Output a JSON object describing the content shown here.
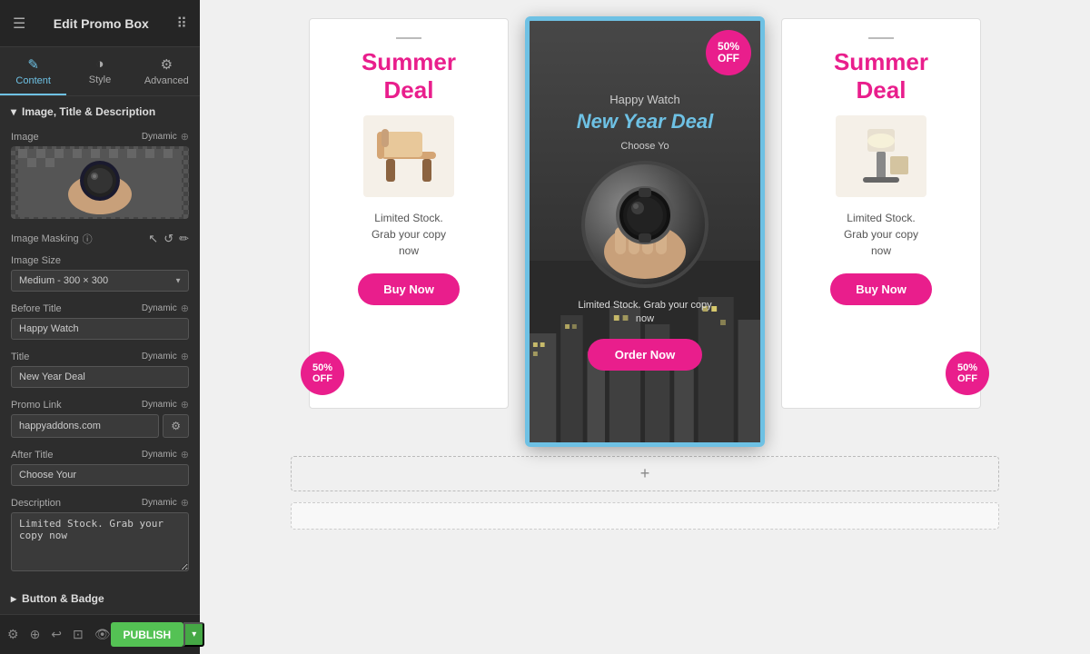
{
  "sidebar": {
    "title": "Edit Promo Box",
    "tabs": [
      {
        "id": "content",
        "label": "Content",
        "icon": "✎",
        "active": true
      },
      {
        "id": "style",
        "label": "Style",
        "icon": "◑",
        "active": false
      },
      {
        "id": "advanced",
        "label": "Advanced",
        "icon": "⚙",
        "active": false
      }
    ],
    "sections": {
      "image_title": {
        "label": "Image, Title & Description",
        "fields": {
          "image_label": "Image",
          "image_dynamic": "Dynamic",
          "image_masking_label": "Image Masking",
          "image_size_label": "Image Size",
          "image_size_value": "Medium - 300 × 300",
          "before_title_label": "Before Title",
          "before_title_dynamic": "Dynamic",
          "before_title_value": "Happy Watch",
          "title_label": "Title",
          "title_dynamic": "Dynamic",
          "title_value": "New Year Deal",
          "promo_link_label": "Promo Link",
          "promo_link_dynamic": "Dynamic",
          "promo_link_value": "happyaddons.com",
          "after_title_label": "After Title",
          "after_title_dynamic": "Dynamic",
          "after_title_value": "Choose Your",
          "description_label": "Description",
          "description_dynamic": "Dynamic",
          "description_value": "Limited Stock. Grab your copy now"
        }
      },
      "button_badge": {
        "label": "Button & Badge"
      }
    },
    "bottom": {
      "publish_label": "PUBLISH"
    }
  },
  "canvas": {
    "left_card": {
      "title": "Summer\nDeal",
      "description": "Limited Stock.\nGrab your copy\nnow",
      "button": "Buy Now",
      "badge_percent": "50%",
      "badge_off": "OFF"
    },
    "center_card": {
      "before_title": "Happy Watch",
      "title": "New Year Deal",
      "after_title": "Choose Yo",
      "description": "Limited Stock. Grab your copy\nnow",
      "button": "Order Now",
      "badge_percent": "50%",
      "badge_off": "OFF"
    },
    "right_card": {
      "title": "Summer\nDeal",
      "description": "Limited Stock.\nGrab your copy\nnow",
      "button": "Buy Now",
      "badge_percent": "50%",
      "badge_off": "OFF"
    }
  },
  "icons": {
    "hamburger": "☰",
    "grid": "⋮⋮",
    "pencil": "✎",
    "circle_half": "◑",
    "gear": "⚙",
    "chevron_down": "▼",
    "chevron_left": "◀",
    "triangle_down": "▾",
    "info": "ⓘ",
    "refresh": "↺",
    "edit_pencil": "✏",
    "settings_gear": "⚙",
    "eye": "👁",
    "responsive": "⊡",
    "undo": "↩",
    "redo": "↪",
    "plus": "+"
  }
}
